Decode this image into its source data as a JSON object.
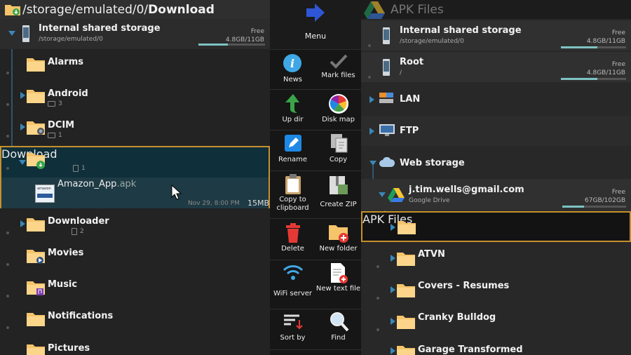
{
  "left": {
    "title_path_prefix": "/storage/emulated/0/",
    "title_path_bold": "Download",
    "storage": {
      "label": "Internal shared storage",
      "path": "/storage/emulated/0",
      "free_label": "Free",
      "free_value": "4.8GB/11GB",
      "used_fraction": 0.44
    },
    "folders": [
      {
        "name": "Alarms",
        "count": ""
      },
      {
        "name": "Android",
        "count": "3"
      },
      {
        "name": "DCIM",
        "count": "1"
      },
      {
        "name": "Download",
        "count": "1"
      },
      {
        "name": "Downloader",
        "count": "2"
      },
      {
        "name": "Movies",
        "count": ""
      },
      {
        "name": "Music",
        "count": ""
      },
      {
        "name": "Notifications",
        "count": ""
      },
      {
        "name": "Pictures",
        "count": ""
      }
    ],
    "file": {
      "name": "Amazon_App",
      "ext": ".apk",
      "date": "Nov 29, 8:00 PM",
      "size": "15MB",
      "icon_text": "amazon"
    }
  },
  "menu": {
    "title": "Menu",
    "items": [
      {
        "label": "News",
        "icon": "info-icon"
      },
      {
        "label": "Mark files",
        "icon": "checkmark-icon"
      },
      {
        "label": "Up dir",
        "icon": "up-arrow-icon"
      },
      {
        "label": "Disk map",
        "icon": "pie-chart-icon"
      },
      {
        "label": "Rename",
        "icon": "pencil-icon"
      },
      {
        "label": "Copy",
        "icon": "copy-icon"
      },
      {
        "label": "Copy to clipboard",
        "icon": "clipboard-icon"
      },
      {
        "label": "Create ZIP",
        "icon": "zip-icon"
      },
      {
        "label": "Delete",
        "icon": "trash-icon"
      },
      {
        "label": "New folder",
        "icon": "new-folder-icon"
      },
      {
        "label": "WiFi server",
        "icon": "wifi-icon"
      },
      {
        "label": "New text file",
        "icon": "new-text-file-icon"
      },
      {
        "label": "Sort by",
        "icon": "sort-icon"
      },
      {
        "label": "Find",
        "icon": "magnifier-icon"
      }
    ]
  },
  "right": {
    "title": "APK Files",
    "internal": {
      "label": "Internal shared storage",
      "path": "/storage/emulated/0",
      "free_label": "Free",
      "free_value": "4.8GB/11GB",
      "used_fraction": 0.56
    },
    "root": {
      "label": "Root",
      "path": "/",
      "free_label": "Free",
      "free_value": "4.8GB/11GB",
      "used_fraction": 0.56
    },
    "lan": "LAN",
    "ftp": "FTP",
    "web_storage": "Web storage",
    "account": {
      "label": "j.tim.wells@gmail.com",
      "sub": "Google Drive",
      "free_label": "Free",
      "free_value": "67GB/102GB",
      "used_fraction": 0.34
    },
    "folders": [
      "APK Files",
      "ATVN",
      "Covers - Resumes",
      "Cranky Bulldog",
      "Garage Transformed"
    ]
  },
  "colors": {
    "accent_selection": "#c7902d",
    "tree_arrow": "#3a88b8",
    "folder": "#f5c46b",
    "bar": "#7ec3c3"
  }
}
